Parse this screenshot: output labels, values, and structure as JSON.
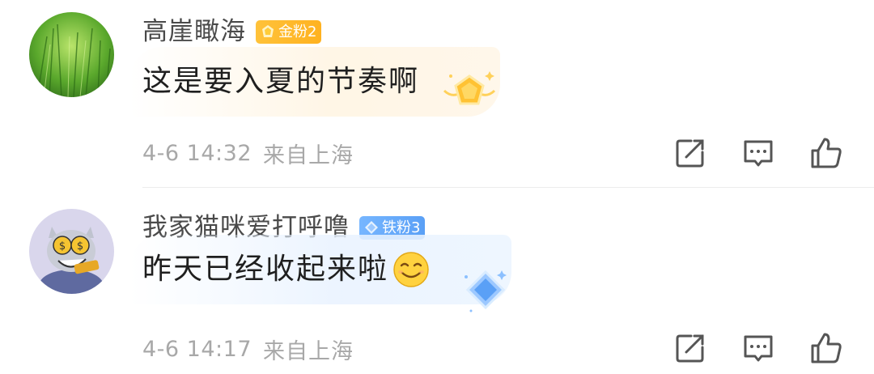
{
  "comments": [
    {
      "username": "高崖瞰海",
      "badge": {
        "label": "金粉2",
        "icon": "crown-icon",
        "color": "#ffb82a"
      },
      "text": "这是要入夏的节奏啊",
      "emoji": "",
      "time": "4-6 14:32",
      "location": "来自上海",
      "avatar": "green-grass-avatar"
    },
    {
      "username": "我家猫咪爱打呼噜",
      "badge": {
        "label": "铁粉3",
        "icon": "diamond-icon",
        "color": "#6aacfa"
      },
      "text": "昨天已经收起来啦",
      "emoji": "smile-emoji",
      "time": "4-6 14:17",
      "location": "来自上海",
      "avatar": "cartoon-cat-avatar"
    }
  ],
  "actions": [
    "share-icon",
    "reply-icon",
    "like-icon"
  ],
  "colors": {
    "meta_gray": "#a8a8a8",
    "name_gray": "#4a4a4a",
    "gold_badge": "#ffb82a",
    "iron_badge": "#6aacfa"
  }
}
